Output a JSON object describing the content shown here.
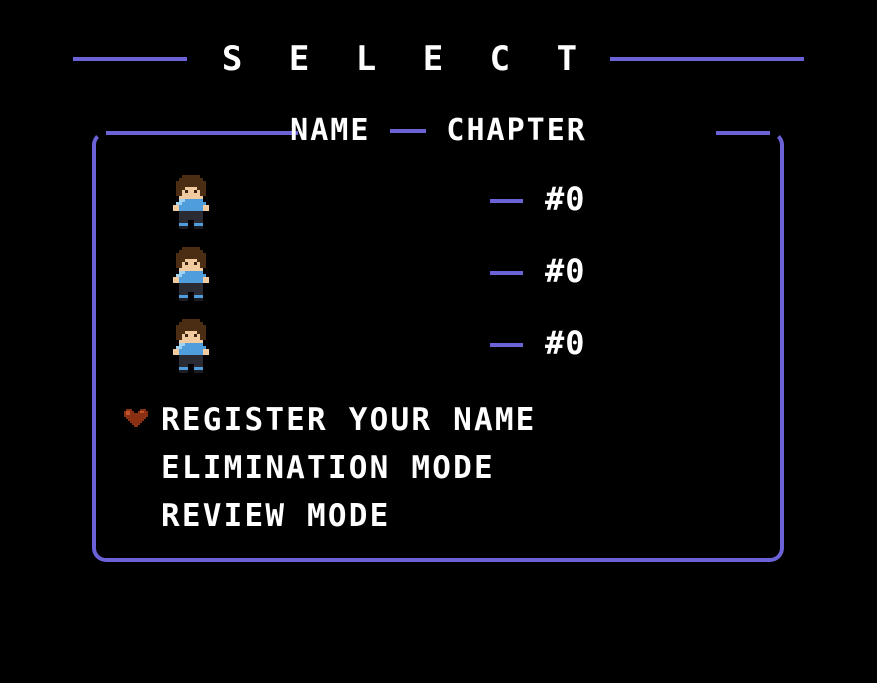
{
  "screen": {
    "background_color": "#000000",
    "accent_color": "#6a62d6",
    "text_color": "#ffffff",
    "soul_color": "#8b2f14"
  },
  "header": {
    "title": "S E L E C T"
  },
  "legend": {
    "name_label": "NAME",
    "separator": "dash",
    "chapter_label": "CHAPTER"
  },
  "save_files": [
    {
      "sprite": "player-sprite",
      "name": "",
      "chapter": "#0"
    },
    {
      "sprite": "player-sprite",
      "name": "",
      "chapter": "#0"
    },
    {
      "sprite": "player-sprite",
      "name": "",
      "chapter": "#0"
    }
  ],
  "menu": {
    "items": [
      {
        "label": "REGISTER YOUR NAME",
        "selected": true
      },
      {
        "label": "ELIMINATION MODE",
        "selected": false
      },
      {
        "label": "REVIEW MODE",
        "selected": false
      }
    ],
    "cursor_icon": "heart-soul-icon"
  }
}
